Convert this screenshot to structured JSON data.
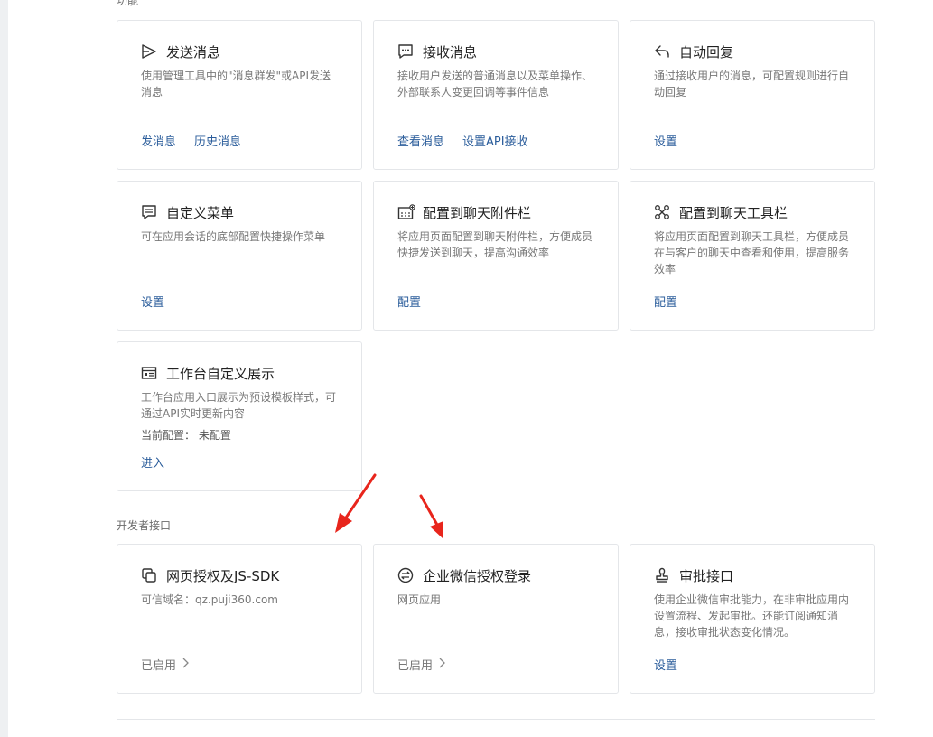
{
  "sections": {
    "features_label": "功能",
    "dev_label": "开发者接口"
  },
  "cards": {
    "send": {
      "icon": "send-icon",
      "title": "发送消息",
      "desc": "使用管理工具中的\"消息群发\"或API发送消息",
      "actions": [
        "发消息",
        "历史消息"
      ]
    },
    "receive": {
      "icon": "chat-bubble-icon",
      "title": "接收消息",
      "desc": "接收用户发送的普通消息以及菜单操作、外部联系人变更回调等事件信息",
      "actions": [
        "查看消息",
        "设置API接收"
      ]
    },
    "autoreply": {
      "icon": "reply-icon",
      "title": "自动回复",
      "desc": "通过接收用户的消息，可配置规则进行自动回复",
      "actions": [
        "设置"
      ]
    },
    "menu": {
      "icon": "menu-icon",
      "title": "自定义菜单",
      "desc": "可在应用会话的底部配置快捷操作菜单",
      "actions": [
        "设置"
      ]
    },
    "attach": {
      "icon": "attachment-bar-icon",
      "title": "配置到聊天附件栏",
      "desc": "将应用页面配置到聊天附件栏，方便成员快捷发送到聊天，提高沟通效率",
      "actions": [
        "配置"
      ]
    },
    "toolbar": {
      "icon": "toolbar-icon",
      "title": "配置到聊天工具栏",
      "desc": "将应用页面配置到聊天工具栏，方便成员在与客户的聊天中查看和使用，提高服务效率",
      "actions": [
        "配置"
      ]
    },
    "workbench": {
      "icon": "workbench-icon",
      "title": "工作台自定义展示",
      "desc": "工作台应用入口展示为预设模板样式，可通过API实时更新内容",
      "extra": "当前配置：  未配置",
      "actions": [
        "进入"
      ]
    },
    "webauth": {
      "icon": "copy-icon",
      "title": "网页授权及JS-SDK",
      "desc": "可信域名：qz.puji360.com",
      "status": "已启用"
    },
    "wxlogin": {
      "icon": "login-icon",
      "title": "企业微信授权登录",
      "desc": "网页应用",
      "status": "已启用"
    },
    "approval": {
      "icon": "stamp-icon",
      "title": "审批接口",
      "desc": "使用企业微信审批能力，在非审批应用内设置流程、发起审批。还能订阅通知消息，接收审批状态变化情况。",
      "actions": [
        "设置"
      ]
    }
  },
  "colors": {
    "link": "#2b5d9b",
    "annotation_arrow": "#e8251c"
  }
}
